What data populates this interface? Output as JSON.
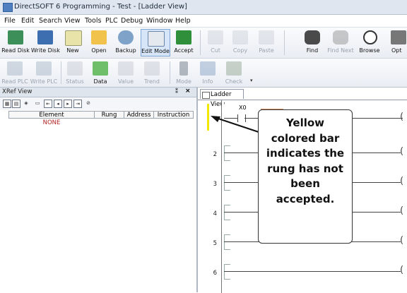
{
  "window": {
    "title": "DirectSOFT 6 Programming - Test - [Ladder View]"
  },
  "menu": [
    "File",
    "Edit",
    "Search",
    "View",
    "Tools",
    "PLC",
    "Debug",
    "Window",
    "Help"
  ],
  "toolbar1": [
    {
      "label": "Read Disk",
      "icon": "read-disk-icon"
    },
    {
      "label": "Write Disk",
      "icon": "write-disk-icon"
    },
    {
      "label": "New",
      "icon": "new-file-icon"
    },
    {
      "label": "Open",
      "icon": "open-folder-icon"
    },
    {
      "label": "Backup",
      "icon": "backup-icon"
    },
    {
      "label": "Edit Mode",
      "icon": "edit-mode-icon"
    },
    {
      "label": "Accept",
      "icon": "accept-icon"
    },
    {
      "label": "Cut",
      "icon": "cut-icon"
    },
    {
      "label": "Copy",
      "icon": "copy-icon"
    },
    {
      "label": "Paste",
      "icon": "paste-icon"
    },
    {
      "label": "Find",
      "icon": "find-icon"
    },
    {
      "label": "Find Next",
      "icon": "find-next-icon"
    },
    {
      "label": "Browse",
      "icon": "browse-icon"
    },
    {
      "label": "Opt",
      "icon": "options-icon"
    }
  ],
  "toolbar2": [
    {
      "label": "Read PLC",
      "icon": "read-plc-icon"
    },
    {
      "label": "Write PLC",
      "icon": "write-plc-icon"
    },
    {
      "label": "Status",
      "icon": "status-icon"
    },
    {
      "label": "Data",
      "icon": "data-icon"
    },
    {
      "label": "Value",
      "icon": "value-icon"
    },
    {
      "label": "Trend",
      "icon": "trend-icon"
    },
    {
      "label": "Mode",
      "icon": "mode-icon"
    },
    {
      "label": "Info",
      "icon": "info-icon"
    },
    {
      "label": "Check",
      "icon": "check-icon"
    }
  ],
  "xref": {
    "title": "XRef View",
    "pin": "⁑",
    "close": "×",
    "columns": [
      "Element",
      "Rung",
      "Address",
      "Instruction"
    ],
    "empty_value": "NONE"
  },
  "ladder": {
    "tab": "Ladder View",
    "contact_label": "X0",
    "rungs": [
      "",
      "2",
      "3",
      "4",
      "5",
      "6"
    ],
    "coil_glyph": "("
  },
  "callout": {
    "lines": [
      "Yellow",
      "colored bar",
      "indicates the",
      "rung has not",
      "been accepted."
    ]
  },
  "colors": {
    "unaccepted_bar": "#f2e800",
    "cursor_highlight": "#f5a97a",
    "none_text": "#b22222"
  }
}
